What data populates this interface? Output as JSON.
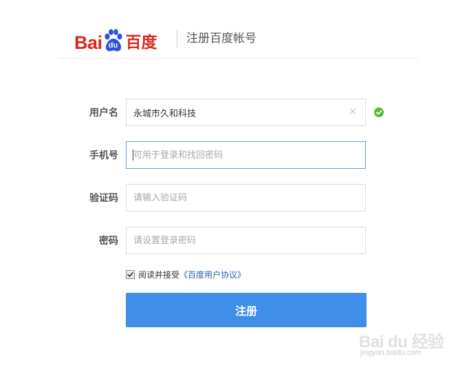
{
  "header": {
    "logo_text_bai": "Bai",
    "logo_text_du": "du",
    "logo_text_cn": "百度",
    "title": "注册百度帐号"
  },
  "form": {
    "username": {
      "label": "用户名",
      "value": "永城市久和科技",
      "placeholder": ""
    },
    "phone": {
      "label": "手机号",
      "value": "",
      "placeholder": "可用于登录和找回密码"
    },
    "code": {
      "label": "验证码",
      "value": "",
      "placeholder": "请输入验证码"
    },
    "password": {
      "label": "密码",
      "value": "",
      "placeholder": "请设置登录密码"
    }
  },
  "agreement": {
    "checked": true,
    "text": "阅读并接受",
    "link": "《百度用户协议》"
  },
  "submit_label": "注册",
  "watermark": {
    "logo": "Bai du 经验",
    "url": "jingyan.baidu.com"
  },
  "colors": {
    "brand_red": "#d9281e",
    "brand_blue": "#2e54d8",
    "button_blue": "#3f8ee8",
    "success_green": "#5ab93a",
    "link_blue": "#2d64b3"
  },
  "icons": {
    "clear": "clear-icon",
    "valid": "check-circle-icon",
    "paw": "paw-icon"
  }
}
